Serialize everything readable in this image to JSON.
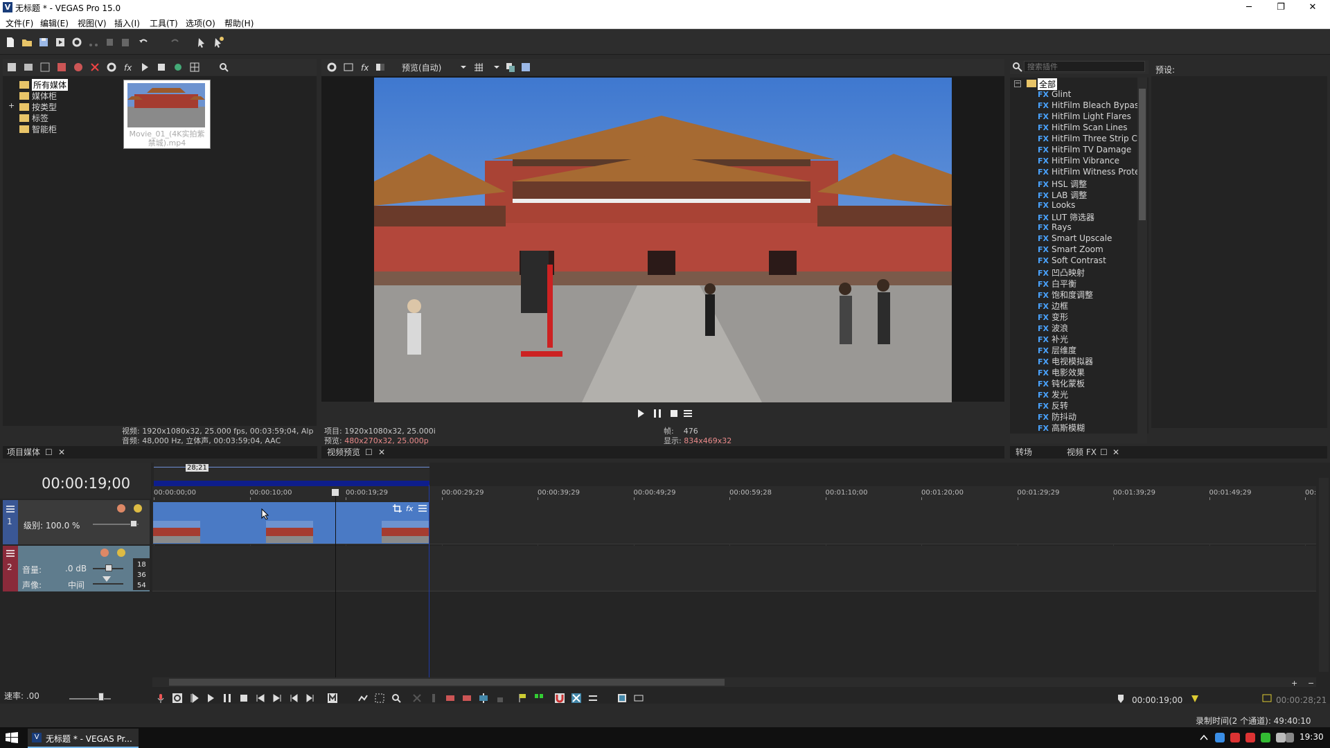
{
  "window": {
    "logo": "V",
    "title": "无标题 * - VEGAS Pro 15.0",
    "minimize": "─",
    "maximize": "❐",
    "close": "✕"
  },
  "menu": [
    "文件(F)",
    "编辑(E)",
    "视图(V)",
    "插入(I)",
    "工具(T)",
    "选项(O)",
    "帮助(H)"
  ],
  "project_media": {
    "tree": [
      {
        "label": "所有媒体",
        "selected": true
      },
      {
        "label": "媒体柜"
      },
      {
        "label": "按类型",
        "expand": "+"
      },
      {
        "label": "标签"
      },
      {
        "label": "智能柜"
      }
    ],
    "media_name": "Movie_01_(4K实拍紫禁城).mp4",
    "info_line1": "视频: 1920x1080x32, 25.000 fps, 00:03:59;04, Alp",
    "info_line2": "音频: 48,000 Hz, 立体声, 00:03:59;04, AAC",
    "tab_label": "项目媒体"
  },
  "preview": {
    "mode_label": "预览(自动)",
    "project_label": "项目:",
    "project_value": "1920x1080x32, 25.000i",
    "preview_label": "预览:",
    "preview_value": "480x270x32, 25.000p",
    "frame_label": "帧:",
    "frame_value": "476",
    "display_label": "显示:",
    "display_value": "834x469x32",
    "tab_label": "视频预览"
  },
  "fx": {
    "search_placeholder": "搜索插件",
    "preset_label": "预设:",
    "root_label": "全部",
    "badge": "FX",
    "items": [
      "Glint",
      "HitFilm Bleach Bypass",
      "HitFilm Light Flares",
      "HitFilm Scan Lines",
      "HitFilm Three Strip Col",
      "HitFilm TV Damage",
      "HitFilm Vibrance",
      "HitFilm Witness Protec",
      "HSL 调整",
      "LAB 调整",
      "Looks",
      "LUT 筛选器",
      "Rays",
      "Smart Upscale",
      "Smart Zoom",
      "Soft Contrast",
      "凹凸映射",
      "白平衡",
      "饱和度调整",
      "边框",
      "变形",
      "波浪",
      "补光",
      "层维度",
      "电视模拟器",
      "电影效果",
      "钝化蒙板",
      "发光",
      "反转",
      "防抖动",
      "高斯模糊"
    ],
    "tab_transitions": "转场",
    "tab_video_fx": "视频 FX"
  },
  "timeline": {
    "time": "00:00:19;00",
    "loop_length": "28;21",
    "ticks": [
      "00:00:00;00",
      "00:00:10;00",
      "00:00:19;29",
      "00:00:29;29",
      "00:00:39;29",
      "00:00:49;29",
      "00:00:59;28",
      "00:01:10;00",
      "00:01:20;00",
      "00:01:29;29",
      "00:01:39;29",
      "00:01:49;29",
      "00:"
    ],
    "track1": {
      "number": "1",
      "level_label": "级别: 100.0 %"
    },
    "track2": {
      "number": "2",
      "volume_label": "音量:",
      "volume_value": ".0 dB",
      "pan_label": "声像:",
      "pan_value": "中间",
      "meter": [
        "18",
        "36",
        "54"
      ]
    },
    "rate_label": "速率: .00",
    "cursor_time": "00:00:19;00",
    "loop_time": "00:00:28;21",
    "record_time": "录制时间(2 个通道): 49:40:10"
  },
  "taskbar": {
    "app_label": "无标题 * - VEGAS Pr...",
    "clock": "19:30"
  },
  "colors": {
    "accent_blue": "#4a7ac5",
    "loop_region": "#0e1e8c",
    "fx_badge": "#4aa3ff",
    "track2_header": "#5f7c8d",
    "preview_pink": "#e98a8a"
  }
}
